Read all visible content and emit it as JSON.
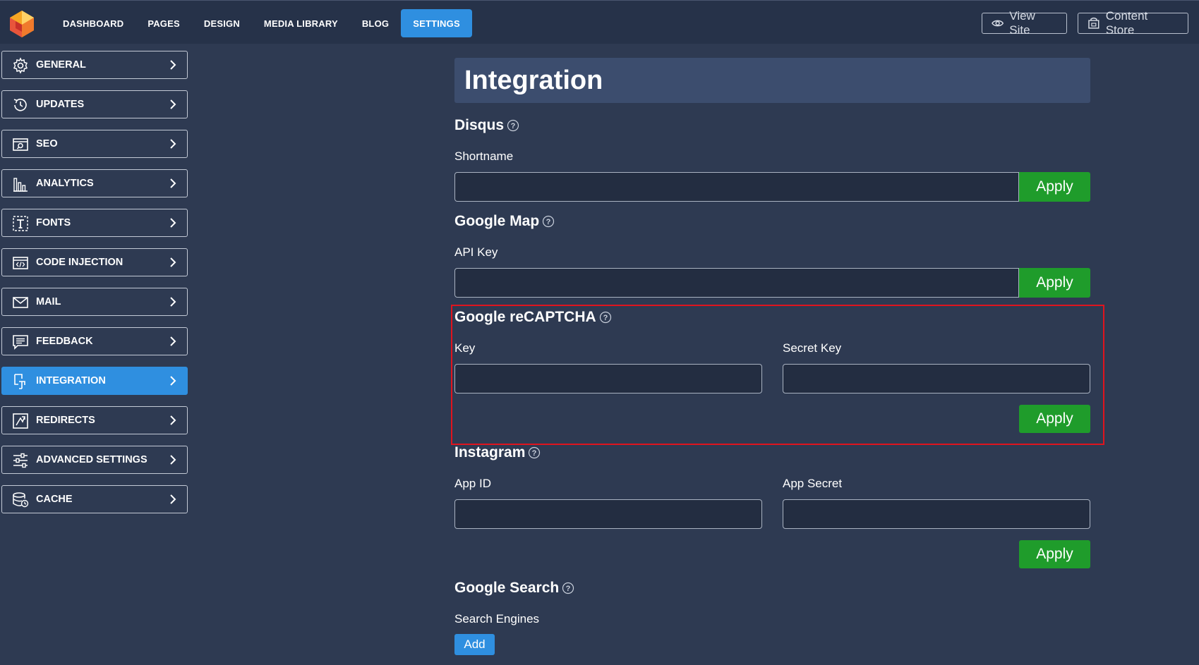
{
  "topbar": {
    "nav": [
      "DASHBOARD",
      "PAGES",
      "DESIGN",
      "MEDIA LIBRARY",
      "BLOG",
      "SETTINGS"
    ],
    "active_nav": "SETTINGS",
    "view_site": "View Site",
    "content_store": "Content Store"
  },
  "sidebar": {
    "items": [
      {
        "label": "GENERAL",
        "icon": "gear-icon"
      },
      {
        "label": "UPDATES",
        "icon": "history-icon"
      },
      {
        "label": "SEO",
        "icon": "seo-icon"
      },
      {
        "label": "ANALYTICS",
        "icon": "bar-chart-icon"
      },
      {
        "label": "FONTS",
        "icon": "font-icon"
      },
      {
        "label": "CODE INJECTION",
        "icon": "code-icon"
      },
      {
        "label": "MAIL",
        "icon": "mail-icon"
      },
      {
        "label": "FEEDBACK",
        "icon": "feedback-icon"
      },
      {
        "label": "INTEGRATION",
        "icon": "integration-icon"
      },
      {
        "label": "REDIRECTS",
        "icon": "redirect-icon"
      },
      {
        "label": "ADVANCED SETTINGS",
        "icon": "sliders-icon"
      },
      {
        "label": "CACHE",
        "icon": "database-icon"
      }
    ],
    "active": "INTEGRATION"
  },
  "main": {
    "title": "Integration",
    "disqus": {
      "title": "Disqus",
      "shortname_label": "Shortname",
      "shortname_value": "",
      "apply": "Apply"
    },
    "google_map": {
      "title": "Google Map",
      "api_key_label": "API Key",
      "api_key_value": "",
      "apply": "Apply"
    },
    "recaptcha": {
      "title": "Google reCAPTCHA",
      "key_label": "Key",
      "key_value": "",
      "secret_label": "Secret Key",
      "secret_value": "",
      "apply": "Apply"
    },
    "instagram": {
      "title": "Instagram",
      "app_id_label": "App ID",
      "app_id_value": "",
      "app_secret_label": "App Secret",
      "app_secret_value": "",
      "apply": "Apply"
    },
    "google_search": {
      "title": "Google Search",
      "engines_label": "Search Engines",
      "add": "Add"
    }
  },
  "colors": {
    "background": "#2e3a52",
    "topbar": "#263249",
    "accent": "#2f8fe0",
    "apply": "#1f9c2b",
    "highlight": "#e0141e"
  }
}
